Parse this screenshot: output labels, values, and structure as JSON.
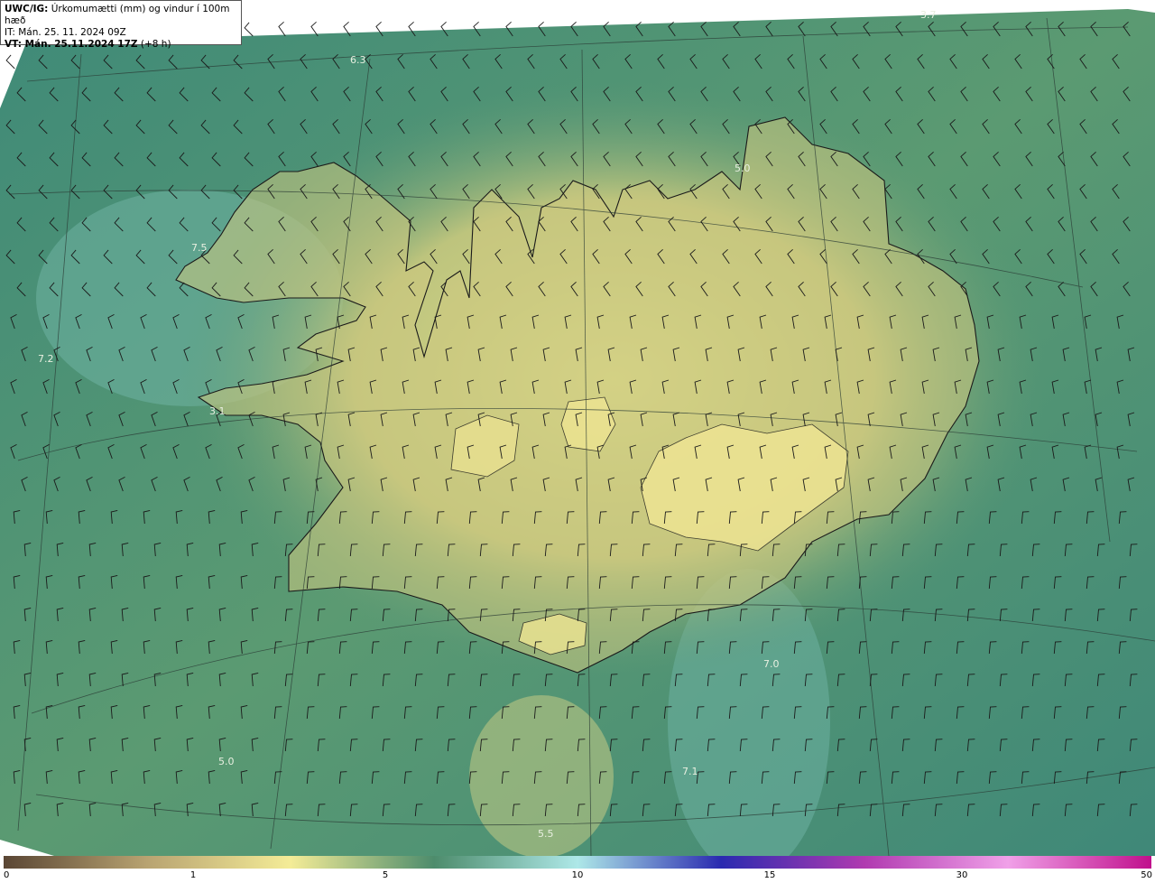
{
  "header": {
    "product": "UWC/IG:",
    "title": "Úrkomumætti (mm) og vindur í 100m hæð",
    "issue_time": "IT: Mán. 25. 11. 2024 09Z",
    "valid_prefix": "VT: Mán. 25.11.2024 17Z",
    "valid_suffix": "(+8 h)"
  },
  "map_labels": [
    {
      "text": "3.7",
      "name": "value-label-3-7"
    },
    {
      "text": "6.3",
      "name": "value-label-6-3"
    },
    {
      "text": "5.0",
      "name": "value-label-5-0-north"
    },
    {
      "text": "7.5",
      "name": "value-label-7-5"
    },
    {
      "text": "7.2",
      "name": "value-label-7-2"
    },
    {
      "text": "3.1",
      "name": "value-label-3-1"
    },
    {
      "text": "7.0",
      "name": "value-label-7-0"
    },
    {
      "text": "7.1",
      "name": "value-label-7-1"
    },
    {
      "text": "5.0",
      "name": "value-label-5-0-south"
    },
    {
      "text": "5.5",
      "name": "value-label-5-5"
    }
  ],
  "colorbar": {
    "ticks": [
      "0",
      "1",
      "5",
      "10",
      "15",
      "30",
      "50"
    ],
    "colors": [
      "#5a4634",
      "#b8a371",
      "#f4ec97",
      "#4d8c6c",
      "#aee8e8",
      "#2a2ab0",
      "#b03ab0",
      "#f0a0e8",
      "#c0108c"
    ]
  },
  "colors": {
    "ocean": "#4a8f78",
    "land": "#d8d48a",
    "coast": "#1a1a1a"
  }
}
